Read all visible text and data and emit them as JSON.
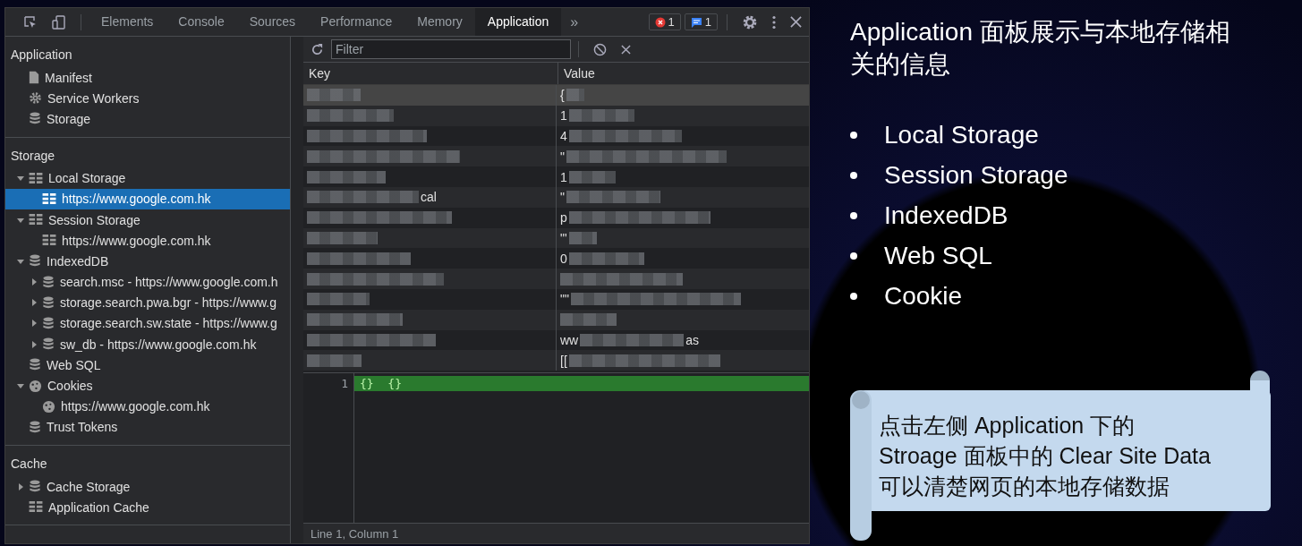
{
  "devtools": {
    "tabs": [
      {
        "label": "Elements",
        "selected": false
      },
      {
        "label": "Console",
        "selected": false
      },
      {
        "label": "Sources",
        "selected": false
      },
      {
        "label": "Performance",
        "selected": false
      },
      {
        "label": "Memory",
        "selected": false
      },
      {
        "label": "Application",
        "selected": true
      }
    ],
    "more_tabs": "»",
    "error_count": "1",
    "message_count": "1",
    "sidebar": [
      {
        "heading": "Application",
        "items": [
          {
            "label": "Manifest",
            "kind": "file"
          },
          {
            "label": "Service Workers",
            "kind": "gear"
          },
          {
            "label": "Storage",
            "kind": "db"
          }
        ]
      },
      {
        "heading": "Storage",
        "items": [
          {
            "label": "Local Storage",
            "kind": "grid",
            "expanded": true,
            "children": [
              {
                "label": "https://www.google.com.hk",
                "kind": "grid",
                "selected": true
              }
            ]
          },
          {
            "label": "Session Storage",
            "kind": "grid",
            "expanded": true,
            "children": [
              {
                "label": "https://www.google.com.hk",
                "kind": "grid",
                "selected": false
              }
            ]
          },
          {
            "label": "IndexedDB",
            "kind": "db",
            "expanded": true,
            "children": [
              {
                "label": "search.msc - https://www.google.com.h",
                "kind": "db",
                "expanded": false,
                "selected": false
              },
              {
                "label": "storage.search.pwa.bgr - https://www.g",
                "kind": "db",
                "expanded": false,
                "selected": false
              },
              {
                "label": "storage.search.sw.state - https://www.g",
                "kind": "db",
                "expanded": false,
                "selected": false
              },
              {
                "label": "sw_db - https://www.google.com.hk",
                "kind": "db",
                "expanded": false,
                "selected": false
              }
            ]
          },
          {
            "label": "Web SQL",
            "kind": "db"
          },
          {
            "label": "Cookies",
            "kind": "cookie",
            "expanded": true,
            "children": [
              {
                "label": "https://www.google.com.hk",
                "kind": "cookie",
                "selected": false
              }
            ]
          },
          {
            "label": "Trust Tokens",
            "kind": "db"
          }
        ]
      },
      {
        "heading": "Cache",
        "items": [
          {
            "label": "Cache Storage",
            "kind": "db",
            "expanded": false
          },
          {
            "label": "Application Cache",
            "kind": "grid"
          }
        ]
      }
    ],
    "filter": {
      "placeholder": "Filter"
    },
    "table": {
      "columns": [
        "Key",
        "Value"
      ],
      "rows": [
        {
          "value": "{",
          "selected": true
        },
        {
          "value": "1",
          "selected": false
        },
        {
          "value": "4",
          "selected": false
        },
        {
          "value": "\"",
          "selected": false
        },
        {
          "value": "1",
          "selected": false
        },
        {
          "key": "cal",
          "value": "\"",
          "selected": false
        },
        {
          "value": "p",
          "selected": false
        },
        {
          "value": "\"'",
          "selected": false
        },
        {
          "value": "0",
          "selected": false
        },
        {
          "selected": false
        },
        {
          "value": "\"\"",
          "selected": false
        },
        {
          "selected": false
        },
        {
          "value": "ww",
          "value_end": "as",
          "selected": false
        },
        {
          "value": "[[",
          "selected": false
        }
      ]
    },
    "editor": {
      "line_number": "1",
      "code": "{}  {}"
    },
    "status_bar": "Line 1, Column 1"
  },
  "slide": {
    "title": "Application 面板展示与本地存储相关的信息",
    "bullets": [
      "Local Storage",
      "Session Storage",
      "IndexedDB",
      "Web SQL",
      "Cookie"
    ],
    "callout": [
      "点击左侧 Application 下的",
      "Stroage 面板中的 Clear Site Data",
      "可以清楚网页的本地存储数据"
    ]
  }
}
